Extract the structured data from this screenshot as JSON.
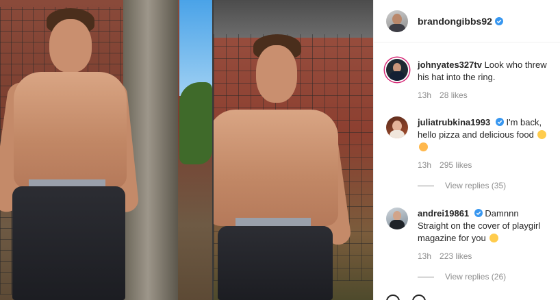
{
  "post": {
    "author": {
      "username": "brandongibbs92",
      "verified": true
    }
  },
  "comments": [
    {
      "username": "johnyates327tv",
      "verified": false,
      "text": "Look who threw his hat into the ring.",
      "time": "13h",
      "likes": "28 likes",
      "avatar_ring": true
    },
    {
      "username": "juliatrubkina1993",
      "verified": true,
      "text": "I'm back, hello pizza and delicious food",
      "emojis": [
        "laughing-emoji",
        "heart-eyes-emoji"
      ],
      "time": "13h",
      "likes": "295 likes",
      "view_replies": "View replies (35)"
    },
    {
      "username": "andrei19861",
      "verified": true,
      "text": "Damnnn Straight on the cover of playgirl magazine for you",
      "emojis": [
        "grimacing-emoji"
      ],
      "time": "13h",
      "likes": "223 likes",
      "view_replies": "View replies (26)"
    }
  ],
  "colors": {
    "text_primary": "#262626",
    "text_secondary": "#8e8e8e",
    "verified_blue": "#3897f0",
    "story_ring": "#d62976"
  }
}
